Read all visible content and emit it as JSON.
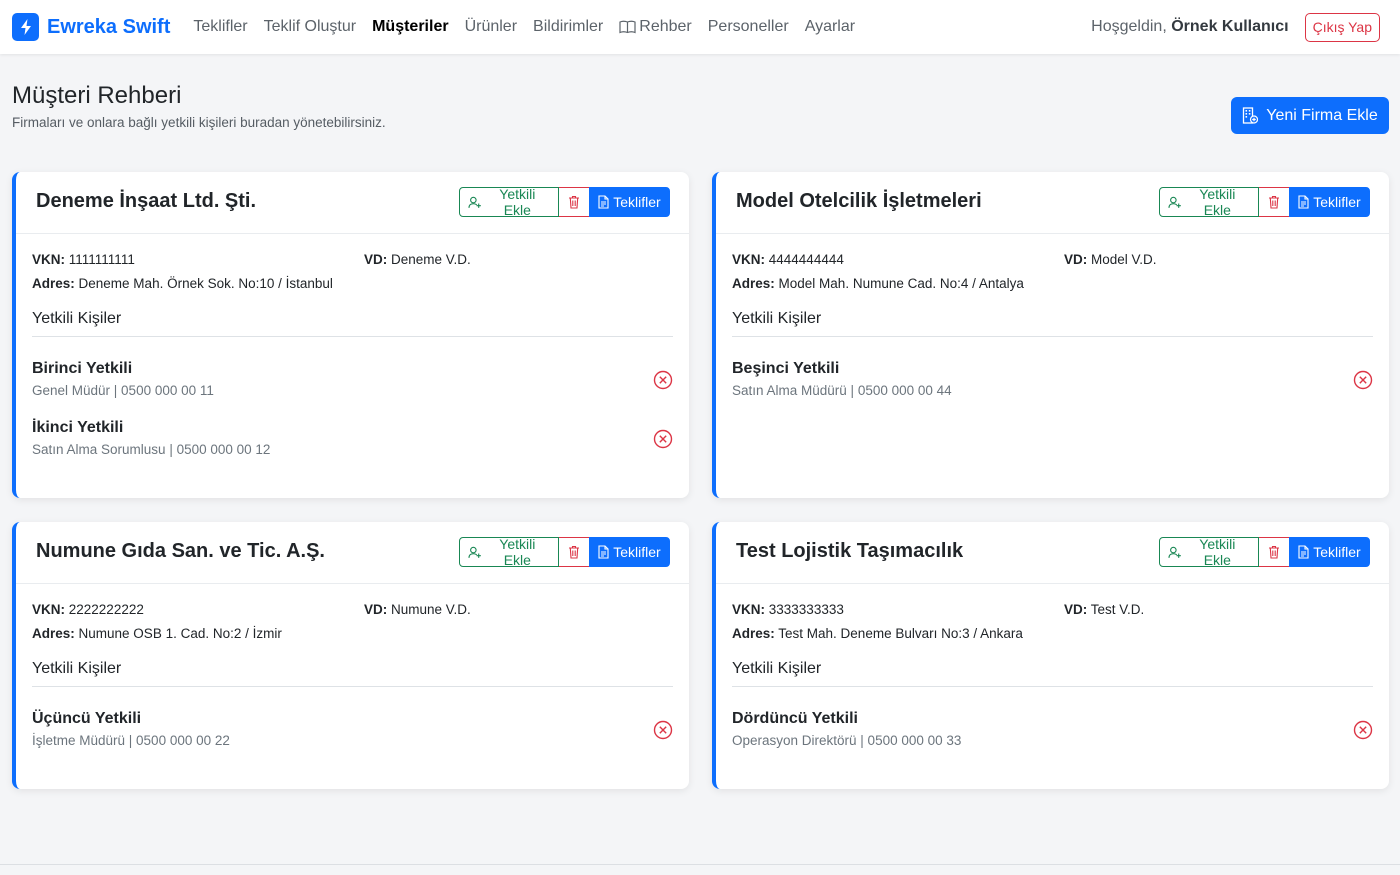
{
  "brand": {
    "name": "Ewreka Swift"
  },
  "nav": {
    "items": [
      "Teklifler",
      "Teklif Oluştur",
      "Müşteriler",
      "Ürünler",
      "Bildirimler",
      "Rehber",
      "Personeller",
      "Ayarlar"
    ],
    "active": "Müşteriler",
    "welcome_prefix": "Hoşgeldin,",
    "user_name": "Örnek Kullanıcı",
    "logout_label": "Çıkış Yap"
  },
  "page": {
    "title": "Müşteri Rehberi",
    "subtitle": "Firmaları ve onlara bağlı yetkili kişileri buradan yönetebilirsiniz.",
    "new_button": "Yeni Firma Ekle"
  },
  "labels": {
    "vkn": "VKN:",
    "vd": "VD:",
    "address": "Adres:",
    "contacts_title": "Yetkili Kişiler",
    "add_contact": "Yetkili Ekle",
    "quotes": "Teklifler"
  },
  "colors": {
    "primary": "#0d6efd",
    "success": "#198754",
    "danger": "#dc3545"
  },
  "firms": [
    {
      "name": "Deneme İnşaat Ltd. Şti.",
      "vkn": "1111111111",
      "vd": "Deneme V.D.",
      "address": "Deneme Mah. Örnek Sok. No:10 / İstanbul",
      "contacts": [
        {
          "name": "Birinci Yetkili",
          "info": "Genel Müdür | 0500 000 00 11"
        },
        {
          "name": "İkinci Yetkili",
          "info": "Satın Alma Sorumlusu | 0500 000 00 12"
        }
      ]
    },
    {
      "name": "Model Otelcilik İşletmeleri",
      "vkn": "4444444444",
      "vd": "Model V.D.",
      "address": "Model Mah. Numune Cad. No:4 / Antalya",
      "contacts": [
        {
          "name": "Beşinci Yetkili",
          "info": "Satın Alma Müdürü | 0500 000 00 44"
        }
      ]
    },
    {
      "name": "Numune Gıda San. ve Tic. A.Ş.",
      "vkn": "2222222222",
      "vd": "Numune V.D.",
      "address": "Numune OSB 1. Cad. No:2 / İzmir",
      "contacts": [
        {
          "name": "Üçüncü Yetkili",
          "info": "İşletme Müdürü | 0500 000 00 22"
        }
      ]
    },
    {
      "name": "Test Lojistik Taşımacılık",
      "vkn": "3333333333",
      "vd": "Test V.D.",
      "address": "Test Mah. Deneme Bulvarı No:3 / Ankara",
      "contacts": [
        {
          "name": "Dördüncü Yetkili",
          "info": "Operasyon Direktörü | 0500 000 00 33"
        }
      ]
    }
  ]
}
